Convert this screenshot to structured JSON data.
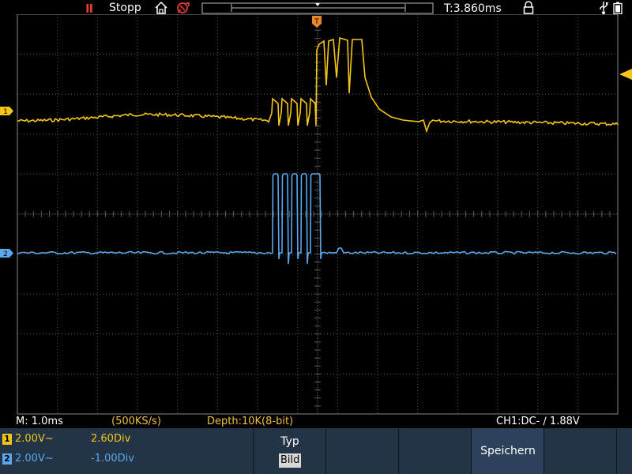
{
  "status": {
    "run_state": "Stopp",
    "trigger_time": "T:3.860ms"
  },
  "info": {
    "timebase": "M: 1.0ms",
    "sample_rate": "(500KS/s)",
    "depth": "Depth:10K(8-bit)",
    "trigger": "CH1:DC-  ∕  1.88V"
  },
  "channels": [
    {
      "number": "1",
      "volts": "2.00V~",
      "offset": "2.60Div",
      "color": "#f5c518"
    },
    {
      "number": "2",
      "volts": "2.00V~",
      "offset": "-1.00Div",
      "color": "#5aa8f0"
    }
  ],
  "menu": {
    "typ_label": "Typ",
    "typ_value": "Bild",
    "save_label": "Speichern"
  },
  "colors": {
    "ch1": "#f5c518",
    "ch2": "#5aa8f0",
    "grid": "#5a5a5a",
    "trigger_marker": "#e8872a",
    "menu_bg": "#243447"
  },
  "icons": [
    "pause-icon",
    "home-icon",
    "probe-icon",
    "lock-icon",
    "usb-icon",
    "battery-icon",
    "trigger-marker-icon",
    "trigger-level-icon"
  ]
}
